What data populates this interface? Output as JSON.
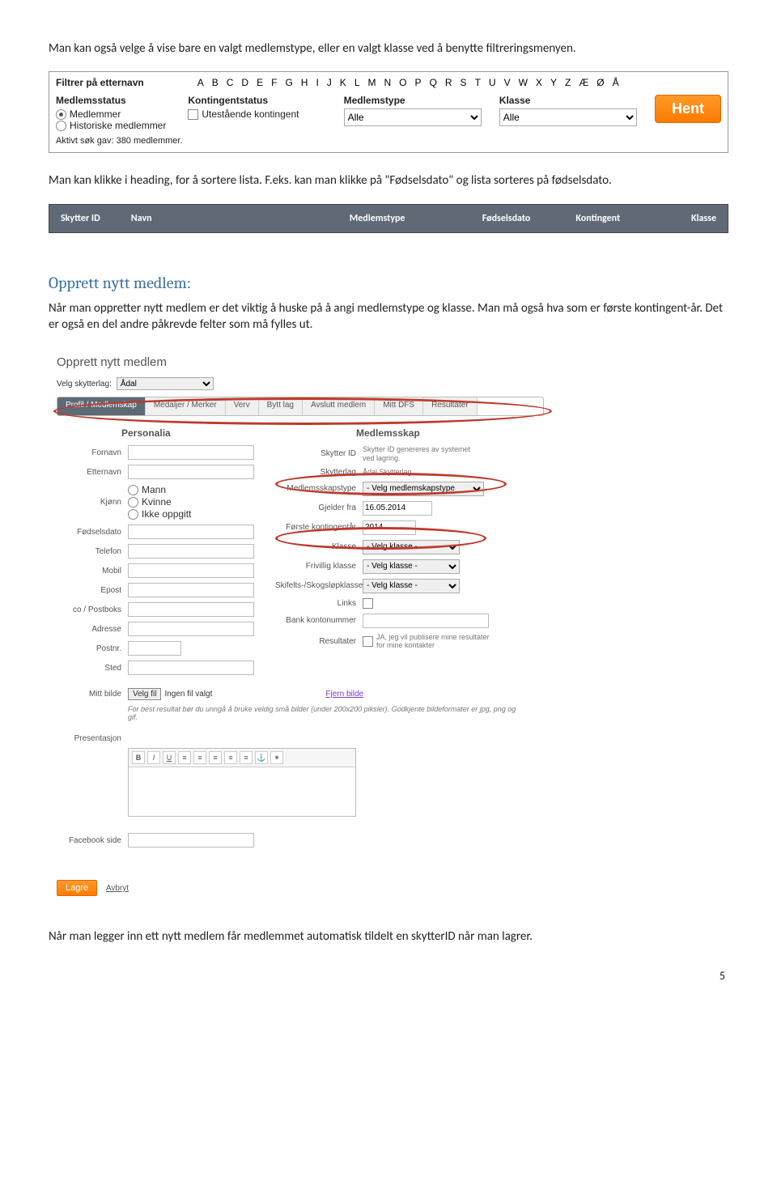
{
  "intro_para": "Man kan også velge å vise bare en valgt medlemstype, eller en valgt klasse ved å benytte filtreringsmenyen.",
  "filter": {
    "surname_label": "Filtrer på etternavn",
    "letters": [
      "A",
      "B",
      "C",
      "D",
      "E",
      "F",
      "G",
      "H",
      "I",
      "J",
      "K",
      "L",
      "M",
      "N",
      "O",
      "P",
      "Q",
      "R",
      "S",
      "T",
      "U",
      "V",
      "W",
      "X",
      "Y",
      "Z",
      "Æ",
      "Ø",
      "Å"
    ],
    "col1_header": "Medlemsstatus",
    "col1_opt1": "Medlemmer",
    "col1_opt2": "Historiske medlemmer",
    "col2_header": "Kontingentstatus",
    "col2_opt1": "Utestående kontingent",
    "col3_header": "Medlemstype",
    "col3_value": "Alle",
    "col4_header": "Klasse",
    "col4_value": "Alle",
    "hent": "Hent",
    "status": "Aktivt søk gav: 380 medlemmer."
  },
  "between1": "Man kan klikke i heading, for å sortere lista. F.eks. kan man klikke på \"Fødselsdato\" og lista sorteres på fødselsdato.",
  "table": {
    "c1": "Skytter ID",
    "c2": "Navn",
    "c3": "Medlemstype",
    "c4": "Fødselsdato",
    "c5": "Kontingent",
    "c6": "Klasse"
  },
  "h2": "Opprett nytt medlem:",
  "para2": "Når man oppretter nytt medlem er det viktig å huske på å angi medlemstype og klasse. Man må også hva som er første kontingent-år. Det er også en del andre påkrevde felter som må fylles ut.",
  "form": {
    "title": "Opprett nytt medlem",
    "velg_label": "Velg skytterlag:",
    "velg_value": "Ådal",
    "tabs": [
      "Profil / Medlemskap",
      "Medaljer / Merker",
      "Verv",
      "Bytt lag",
      "Avslutt medlem",
      "Mitt DFS",
      "Resultater"
    ],
    "left_header": "Personalia",
    "right_header": "Medlemsskap",
    "fornavn": "Fornavn",
    "etternavn": "Etternavn",
    "kjonn": "Kjønn",
    "kj_m": "Mann",
    "kj_k": "Kvinne",
    "kj_i": "Ikke oppgitt",
    "fodselsdato": "Fødselsdato",
    "telefon": "Telefon",
    "mobil": "Mobil",
    "epost": "Epost",
    "postboks": "co / Postboks",
    "adresse": "Adresse",
    "postnr": "Postnr.",
    "sted": "Sted",
    "mittbilde": "Mitt bilde",
    "skytterid": "Skytter ID",
    "skytterid_note": "Skytter ID genereres av systemet ved lagring.",
    "skytterlag": "Skytterlag",
    "skytterlag_note": "Ådal Skytterlag",
    "mtype": "Medlemsskapstype",
    "mtype_val": "- Velg medlemskapstype",
    "gjelder": "Gjelder fra",
    "gjelder_val": "16.05.2014",
    "forste": "Første kontingentår",
    "forste_val": "2014",
    "klasse": "Klasse",
    "klasse_val": "- Velg klasse -",
    "frivillig": "Frivillig klasse",
    "frivillig_val": "- Velg klasse -",
    "skifelt": "Skifelts-/Skogsløpklasse",
    "skifelt_val": "- Velg klasse -",
    "links": "Links",
    "bank": "Bank kontonummer",
    "resultater": "Resultater",
    "resultater_chk": "JA, jeg vil publisere mine resultater for mine kontakter",
    "velgfil": "Velg fil",
    "ingenfil": "Ingen fil valgt",
    "fjern": "Fjern bilde",
    "bildehelp": "For best resultat bør du unngå å bruke veldig små bilder (under 200x200 piksler). Godkjente bildeformater er jpg, png og gif.",
    "presentasjon": "Presentasjon",
    "facebook": "Facebook side",
    "lagre": "Lagre",
    "avbryt": "Avbryt"
  },
  "closing": "Når man legger inn ett nytt medlem får medlemmet automatisk tildelt en skytterID når man lagrer.",
  "pagenum": "5"
}
